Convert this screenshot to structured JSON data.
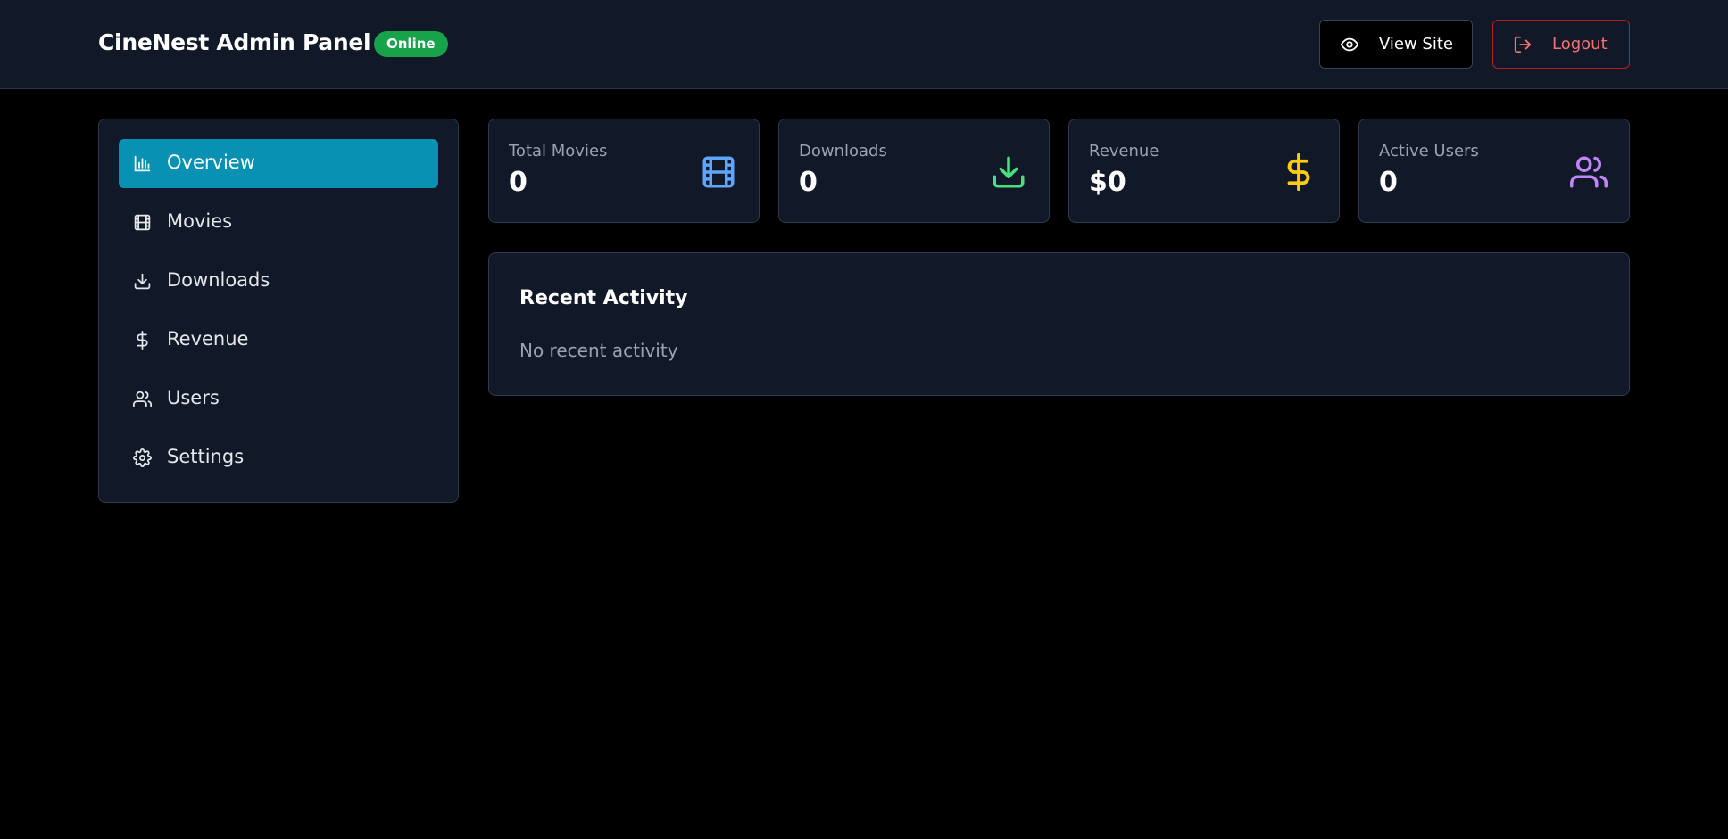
{
  "header": {
    "title": "CineNest Admin Panel",
    "status": "Online",
    "view_site_label": "View Site",
    "logout_label": "Logout"
  },
  "sidebar": {
    "items": [
      {
        "label": "Overview",
        "icon": "bar-chart-icon",
        "active": true
      },
      {
        "label": "Movies",
        "icon": "film-icon",
        "active": false
      },
      {
        "label": "Downloads",
        "icon": "download-icon",
        "active": false
      },
      {
        "label": "Revenue",
        "icon": "dollar-icon",
        "active": false
      },
      {
        "label": "Users",
        "icon": "users-icon",
        "active": false
      },
      {
        "label": "Settings",
        "icon": "gear-icon",
        "active": false
      }
    ]
  },
  "stats": [
    {
      "label": "Total Movies",
      "value": "0",
      "icon": "film-icon",
      "color": "#60a5fa"
    },
    {
      "label": "Downloads",
      "value": "0",
      "icon": "download-icon",
      "color": "#4ade80"
    },
    {
      "label": "Revenue",
      "value": "$0",
      "icon": "dollar-icon",
      "color": "#facc15"
    },
    {
      "label": "Active Users",
      "value": "0",
      "icon": "users-icon",
      "color": "#c084fc"
    }
  ],
  "activity": {
    "title": "Recent Activity",
    "empty_text": "No recent activity"
  },
  "colors": {
    "accent": "#0891b2",
    "online": "#16a34a",
    "danger": "#f87171"
  }
}
